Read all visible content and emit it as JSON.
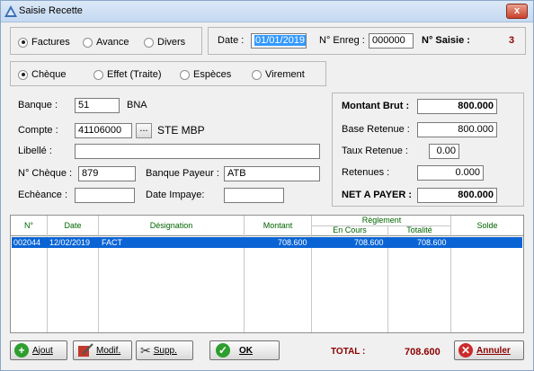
{
  "window": {
    "title": "Saisie Recette",
    "close_label": "x"
  },
  "mode": {
    "options": [
      "Factures",
      "Avance",
      "Divers"
    ],
    "selected": 0
  },
  "header": {
    "date_label": "Date :",
    "date_value": "01/01/2019",
    "enreg_label": "N° Enreg :",
    "enreg_value": "000000",
    "saisie_label": "N° Saisie :",
    "saisie_value": "3"
  },
  "payment": {
    "options": [
      "Chèque",
      "Effet (Traite)",
      "Espèces",
      "Virement"
    ],
    "selected": 0
  },
  "form": {
    "banque_label": "Banque :",
    "banque_code": "51",
    "banque_name": "BNA",
    "compte_label": "Compte :",
    "compte_value": "41106000",
    "dots": "...",
    "compte_name": "STE MBP",
    "libelle_label": "Libellé :",
    "libelle_value": "",
    "cheque_label": "N° Chèque :",
    "cheque_value": "879",
    "banque_payeur_label": "Banque Payeur :",
    "banque_payeur_value": "ATB",
    "echeance_label": "Echèance :",
    "echeance_value": "",
    "date_impaye_label": "Date Impaye:",
    "date_impaye_value": ""
  },
  "totals": {
    "brut_label": "Montant Brut :",
    "brut_value": "800.000",
    "base_label": "Base Retenue :",
    "base_value": "800.000",
    "taux_label": "Taux Retenue :",
    "taux_value": "0.00",
    "retenues_label": "Retenues :",
    "retenues_value": "0.000",
    "net_label": "NET A PAYER :",
    "net_value": "800.000"
  },
  "table": {
    "headers": {
      "num": "N°",
      "date": "Date",
      "designation": "Désignation",
      "montant": "Montant",
      "reglement": "Règlement",
      "en_cours": "En Cours",
      "totalite": "Totalité",
      "solde": "Solde"
    },
    "rows": [
      {
        "num": "002044",
        "date": "12/02/2019",
        "designation": "FACT",
        "montant": "708.600",
        "en_cours": "708.600",
        "totalite": "708.600",
        "solde": ""
      }
    ]
  },
  "footer": {
    "ajout": "Ajout",
    "modif": "Modif.",
    "supp": "Supp.",
    "ok": "OK",
    "total_label": "TOTAL :",
    "total_value": "708.600",
    "annuler": "Annuler"
  }
}
